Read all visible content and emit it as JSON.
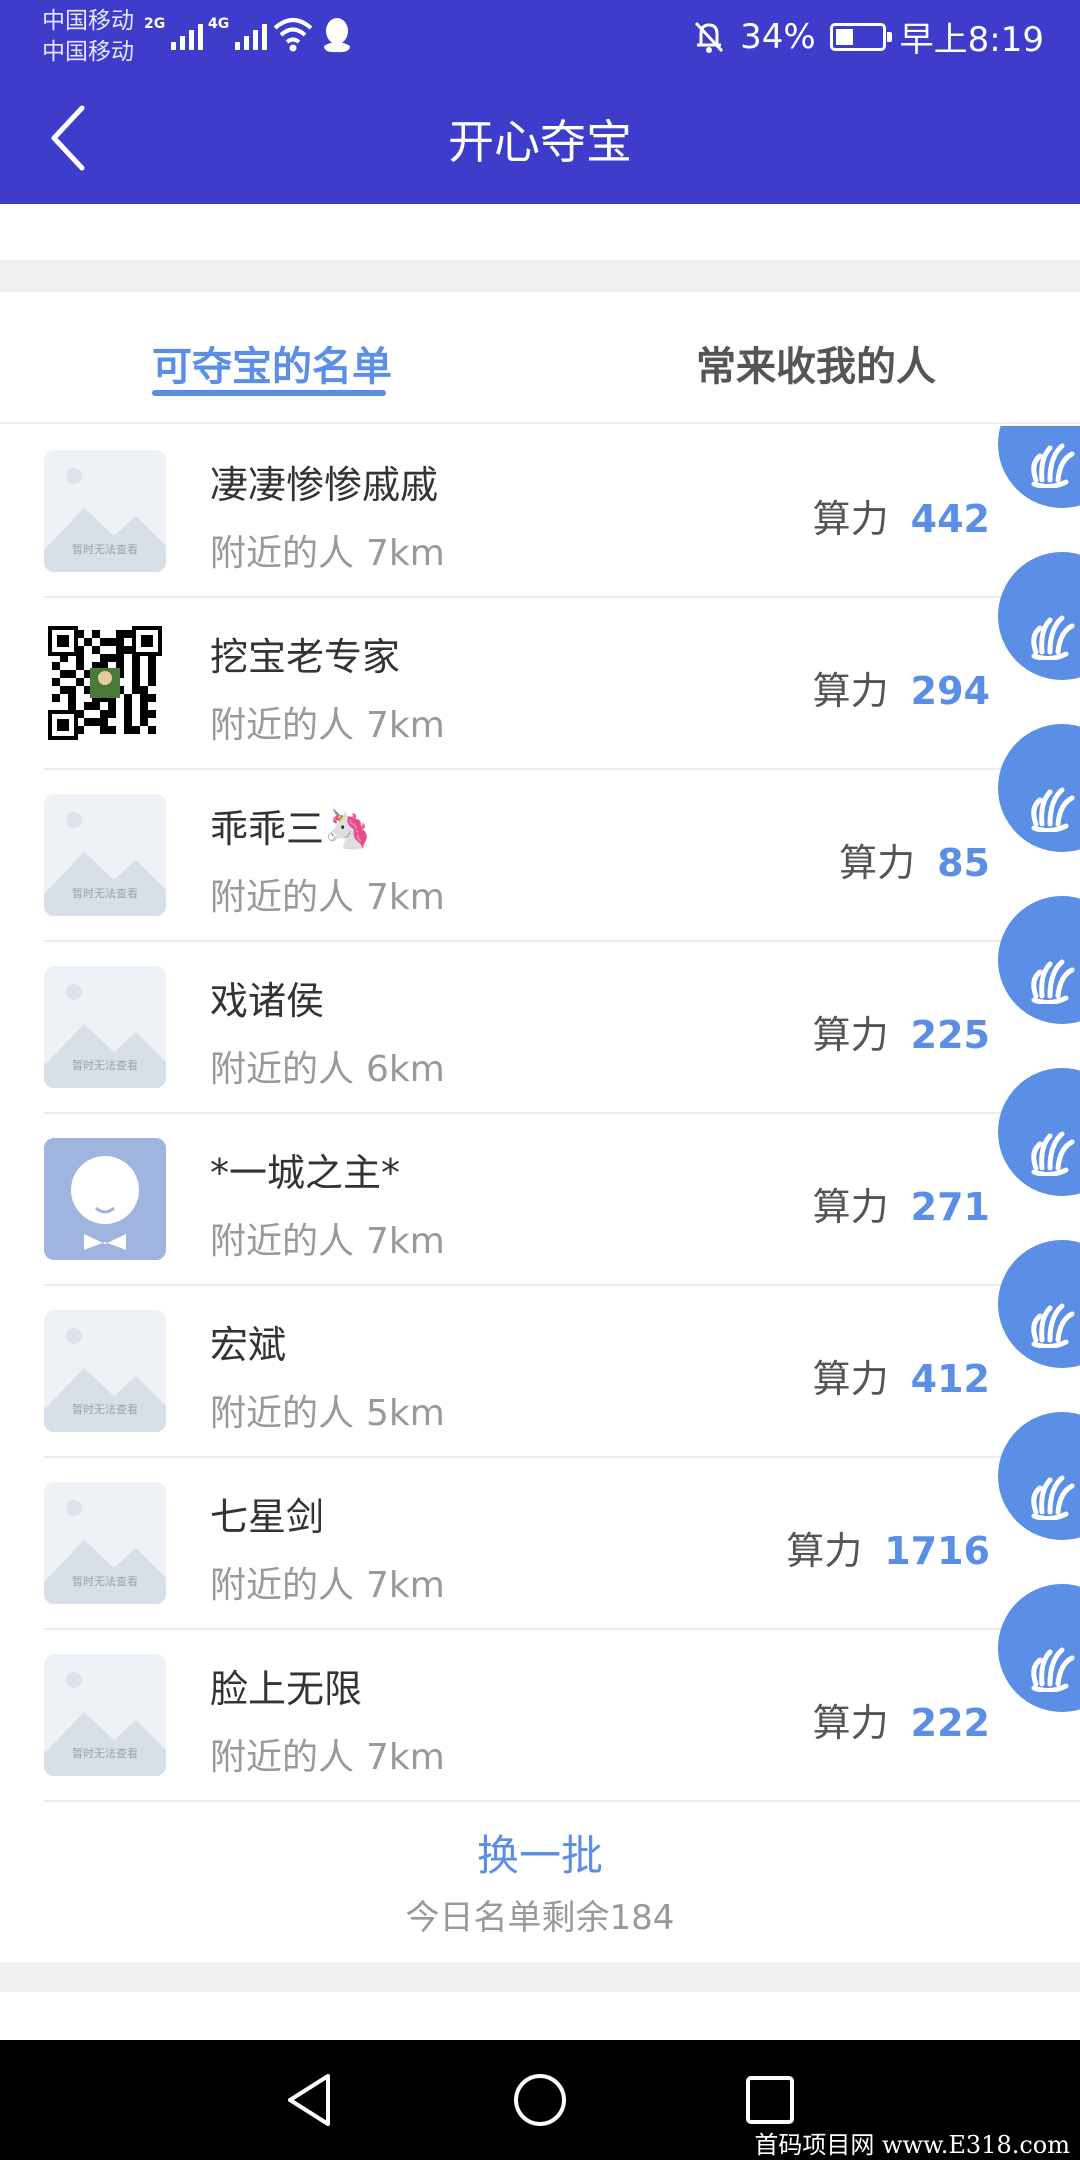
{
  "status_bar": {
    "carrier_1": "中国移动",
    "carrier_2": "中国移动",
    "net_1": "2G",
    "net_2": "4G",
    "battery": "34%",
    "battery_level": 0.34,
    "time": "早上8:19"
  },
  "header": {
    "title": "开心夺宝"
  },
  "tabs": [
    {
      "label": "可夺宝的名单",
      "active": true
    },
    {
      "label": "常来收我的人",
      "active": false
    }
  ],
  "list": {
    "nearby_label": "附近的人",
    "power_label": "算力",
    "items": [
      {
        "name": "凄凄惨惨戚戚",
        "distance": "7km",
        "power": "442",
        "avatar": "placeholder"
      },
      {
        "name": "挖宝老专家",
        "distance": "7km",
        "power": "294",
        "avatar": "qr-code"
      },
      {
        "name": "乖乖三🦄",
        "distance": "7km",
        "power": "85",
        "avatar": "placeholder"
      },
      {
        "name": "戏诸侯",
        "distance": "6km",
        "power": "225",
        "avatar": "placeholder"
      },
      {
        "name": "*一城之主*",
        "distance": "7km",
        "power": "271",
        "avatar": "default-user"
      },
      {
        "name": "宏斌",
        "distance": "5km",
        "power": "412",
        "avatar": "placeholder"
      },
      {
        "name": "七星剑",
        "distance": "7km",
        "power": "1716",
        "avatar": "placeholder"
      },
      {
        "name": "脸上无限",
        "distance": "7km",
        "power": "222",
        "avatar": "placeholder"
      }
    ],
    "placeholder_text": "暂时无法查看"
  },
  "footer": {
    "refresh_label": "换一批",
    "remaining_text": "今日名单剩余184"
  },
  "watermark": "首码项目网 www.E318.com",
  "colors": {
    "header_bg": "#3d3ccb",
    "accent": "#5b8fe6"
  }
}
